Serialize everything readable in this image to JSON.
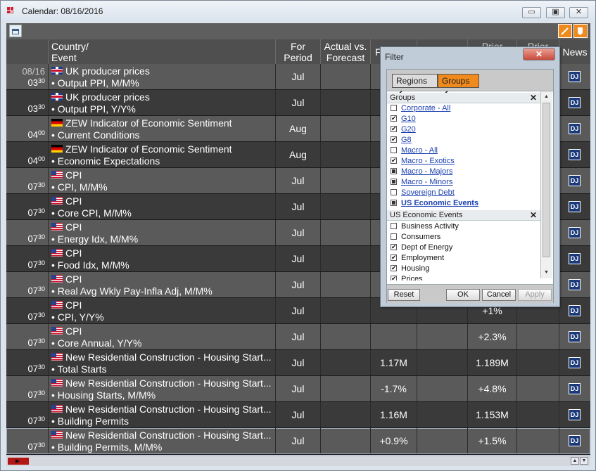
{
  "window": {
    "title": "Calendar: 08/16/2016",
    "min": "▭",
    "max": "▣",
    "close": "✕"
  },
  "columns": {
    "event": [
      "Country/",
      "Event"
    ],
    "period": [
      "For",
      "Period"
    ],
    "avf": [
      "Actual vs.",
      "Forecast"
    ],
    "forecast": [
      "F"
    ],
    "actual": [
      ""
    ],
    "prior": [
      "Prior"
    ],
    "prior2": [
      "Prior"
    ],
    "news": [
      "News"
    ]
  },
  "rows": [
    {
      "date": "08/16",
      "time": "03",
      "min": "30",
      "flag": "uk",
      "l1": "UK producer prices",
      "l2": "• Output PPI, M/M%",
      "period": "Jul",
      "forecast": "",
      "prior": ""
    },
    {
      "date": "",
      "time": "03",
      "min": "30",
      "flag": "uk",
      "l1": "UK producer prices",
      "l2": "• Output PPI, Y/Y%",
      "period": "Jul",
      "forecast": "",
      "prior": ""
    },
    {
      "date": "",
      "time": "04",
      "min": "00",
      "flag": "de",
      "l1": "ZEW Indicator of Economic Sentiment",
      "l2": "• Current Conditions",
      "period": "Aug",
      "forecast": "",
      "prior": ""
    },
    {
      "date": "",
      "time": "04",
      "min": "00",
      "flag": "de",
      "l1": "ZEW Indicator of Economic Sentiment",
      "l2": "• Economic Expectations",
      "period": "Aug",
      "forecast": "",
      "prior": ""
    },
    {
      "date": "",
      "time": "07",
      "min": "30",
      "flag": "us",
      "l1": "CPI",
      "l2": "• CPI, M/M%",
      "period": "Jul",
      "forecast": "",
      "prior": ""
    },
    {
      "date": "",
      "time": "07",
      "min": "30",
      "flag": "us",
      "l1": "CPI",
      "l2": "• Core CPI, M/M%",
      "period": "Jul",
      "forecast": "",
      "prior": ""
    },
    {
      "date": "",
      "time": "07",
      "min": "30",
      "flag": "us",
      "l1": "CPI",
      "l2": "• Energy Idx, M/M%",
      "period": "Jul",
      "forecast": "",
      "prior": ""
    },
    {
      "date": "",
      "time": "07",
      "min": "30",
      "flag": "us",
      "l1": "CPI",
      "l2": "• Food Idx, M/M%",
      "period": "Jul",
      "forecast": "",
      "prior": ""
    },
    {
      "date": "",
      "time": "07",
      "min": "30",
      "flag": "us",
      "l1": "CPI",
      "l2": "• Real Avg Wkly Pay-Infla Adj, M/M%",
      "period": "Jul",
      "forecast": "",
      "prior": ""
    },
    {
      "date": "",
      "time": "07",
      "min": "30",
      "flag": "us",
      "l1": "CPI",
      "l2": "• CPI, Y/Y%",
      "period": "Jul",
      "forecast": "",
      "prior": "+1%"
    },
    {
      "date": "",
      "time": "07",
      "min": "30",
      "flag": "us",
      "l1": "CPI",
      "l2": "• Core Annual, Y/Y%",
      "period": "Jul",
      "forecast": "",
      "prior": "+2.3%"
    },
    {
      "date": "",
      "time": "07",
      "min": "30",
      "flag": "us",
      "l1": "New Residential Construction - Housing Start...",
      "l2": "• Total Starts",
      "period": "Jul",
      "forecast": "1.17M",
      "prior": "1.189M"
    },
    {
      "date": "",
      "time": "07",
      "min": "30",
      "flag": "us",
      "l1": "New Residential Construction - Housing Start...",
      "l2": "• Housing Starts, M/M%",
      "period": "Jul",
      "forecast": "-1.7%",
      "prior": "+4.8%"
    },
    {
      "date": "",
      "time": "07",
      "min": "30",
      "flag": "us",
      "l1": "New Residential Construction - Housing Start...",
      "l2": "• Building Permits",
      "period": "Jul",
      "forecast": "1.16M",
      "prior": "1.153M"
    },
    {
      "date": "",
      "time": "07",
      "min": "30",
      "flag": "us",
      "l1": "New Residential Construction - Housing Start...",
      "l2": "• Building Permits, M/M%",
      "period": "Jul",
      "forecast": "+0.9%",
      "prior": "+1.5%"
    }
  ],
  "news_label": "DJ",
  "filter": {
    "title": "Filter",
    "tabs": {
      "regions": "Regions ✔",
      "groups": "Groups ✔"
    },
    "groups_header": "Groups",
    "groups": [
      {
        "label": "Corporate - All",
        "state": "off",
        "link": true
      },
      {
        "label": "G10",
        "state": "on",
        "link": true
      },
      {
        "label": "G20",
        "state": "on",
        "link": true
      },
      {
        "label": "G8",
        "state": "on",
        "link": true
      },
      {
        "label": "Macro - All",
        "state": "off",
        "link": true
      },
      {
        "label": "Macro - Exotics",
        "state": "on",
        "link": true
      },
      {
        "label": "Macro - Majors",
        "state": "part",
        "link": true
      },
      {
        "label": "Macro - Minors",
        "state": "part",
        "link": true
      },
      {
        "label": "Sovereign Debt",
        "state": "off",
        "link": true
      },
      {
        "label": "US Economic Events",
        "state": "part",
        "link": true,
        "bold": true
      }
    ],
    "sub_header": "US Economic Events",
    "sub_items": [
      {
        "label": "Business Activity",
        "state": "off"
      },
      {
        "label": "Consumers",
        "state": "off"
      },
      {
        "label": "Dept of Energy",
        "state": "on"
      },
      {
        "label": "Employment",
        "state": "on"
      },
      {
        "label": "Housing",
        "state": "on"
      },
      {
        "label": "Prices",
        "state": "on"
      }
    ],
    "buttons": {
      "reset": "Reset",
      "ok": "OK",
      "cancel": "Cancel",
      "apply": "Apply"
    }
  },
  "colors": {
    "accent": "#f08a1c",
    "row_a": "#5a5a5a",
    "row_b": "#3a3a3a",
    "header": "#4f4f4f"
  }
}
